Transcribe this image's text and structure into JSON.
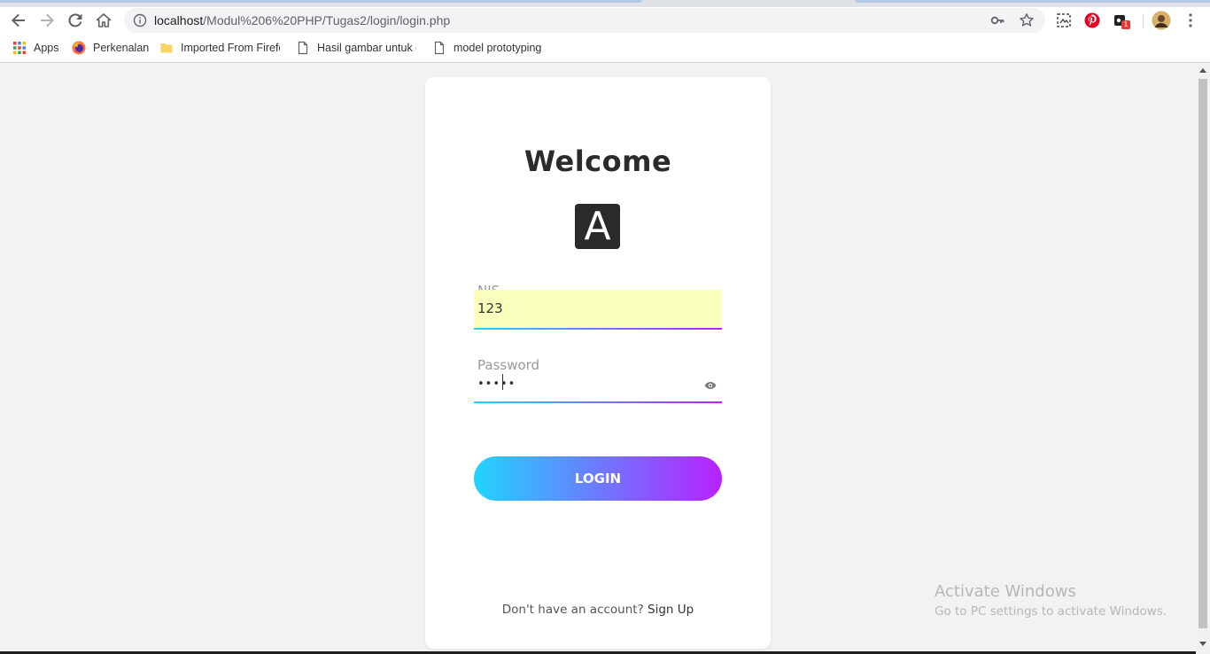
{
  "browser": {
    "url_host": "localhost",
    "url_path": "/Modul%206%20PHP/Tugas2/login/login.php",
    "bookmarks": [
      {
        "label": "Apps",
        "icon": "apps-grid-icon"
      },
      {
        "label": "Perkenalan",
        "icon": "firefox-icon"
      },
      {
        "label": "Imported From Firefc",
        "icon": "folder-icon"
      },
      {
        "label": "Hasil gambar untuk c",
        "icon": "page-icon"
      },
      {
        "label": "model prototyping",
        "icon": "page-icon"
      }
    ],
    "extension_badge": "1"
  },
  "login": {
    "title": "Welcome",
    "logo_letter": "A",
    "nis_label": "NIS",
    "nis_value": "123",
    "password_label": "Password",
    "password_mask": "•••••",
    "button_label": "LOGIN",
    "signup_prompt": "Don't have an account?",
    "signup_link": "Sign Up"
  },
  "watermark": {
    "line1": "Activate Windows",
    "line2": "Go to PC settings to activate Windows."
  },
  "colors": {
    "gradient_start": "#21d4fd",
    "gradient_end": "#b721ff",
    "autofill_bg": "#faffbd",
    "page_bg": "#f2f2f2"
  }
}
